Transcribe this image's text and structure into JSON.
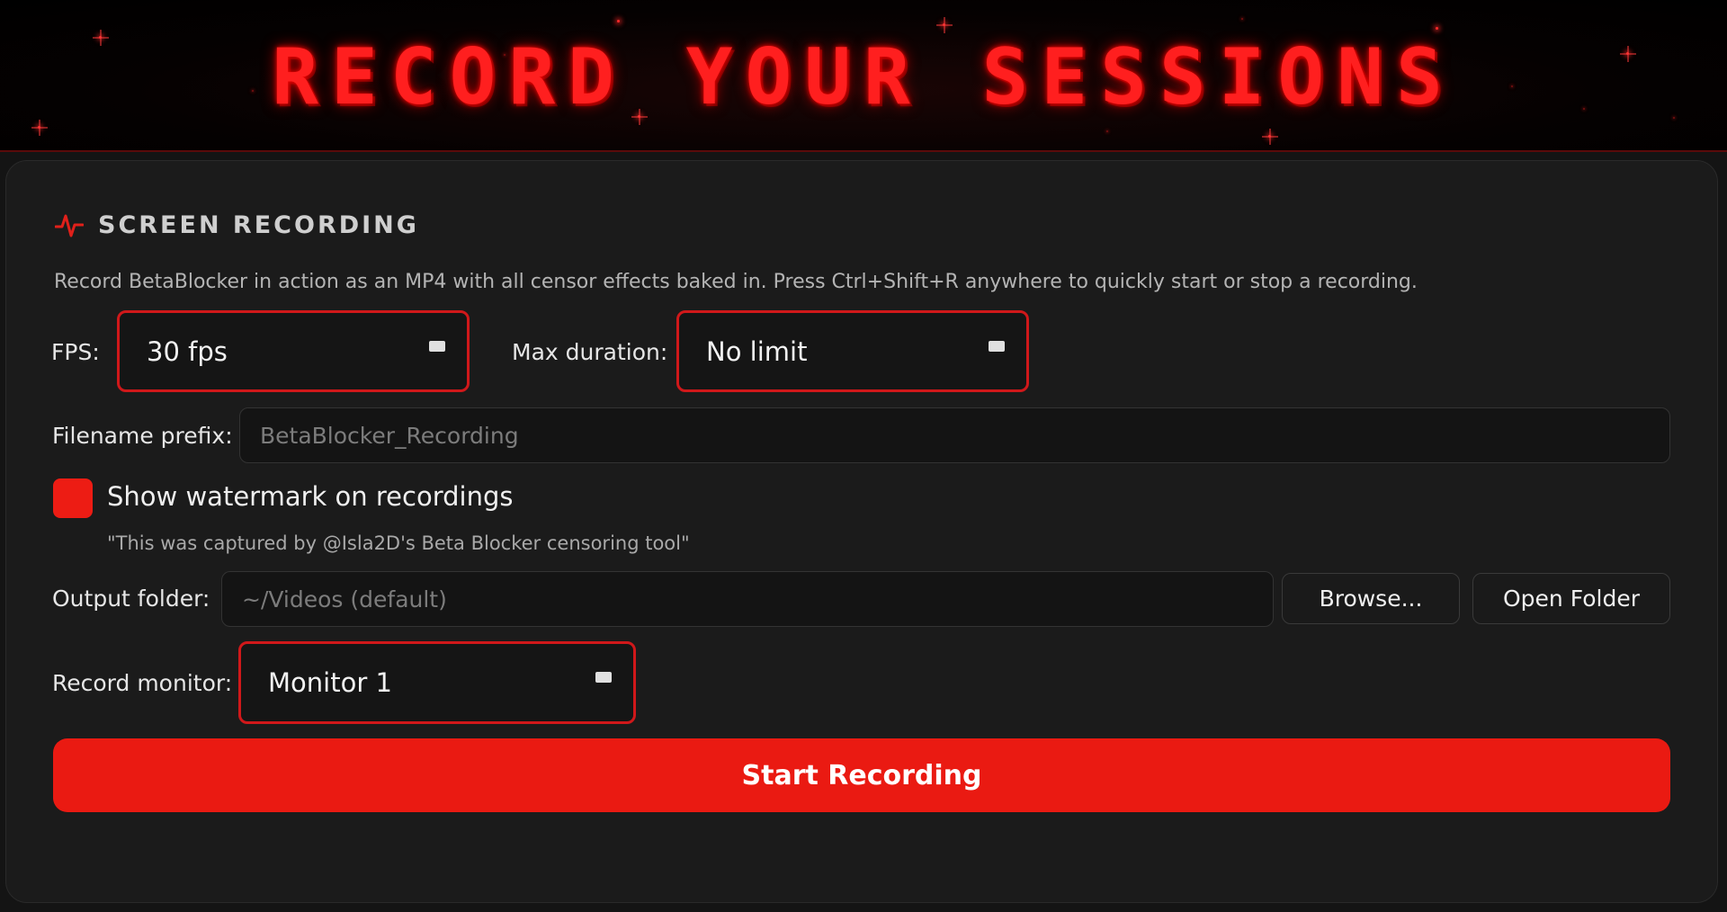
{
  "banner": {
    "title": "RECORD YOUR SESSIONS"
  },
  "section": {
    "icon": "pulse-icon",
    "title": "SCREEN RECORDING",
    "description": "Record BetaBlocker in action as an MP4 with all censor effects baked in.  Press Ctrl+Shift+R anywhere to quickly start or stop a recording."
  },
  "fps": {
    "label": "FPS:",
    "value": "30 fps"
  },
  "max_duration": {
    "label": "Max duration:",
    "value": "No limit"
  },
  "filename_prefix": {
    "label": "Filename prefix:",
    "placeholder": "BetaBlocker_Recording"
  },
  "watermark": {
    "label": "Show watermark on recordings",
    "checked": true,
    "note": "\"This was captured by @Isla2D's Beta Blocker censoring tool\""
  },
  "output_folder": {
    "label": "Output folder:",
    "placeholder": "~/Videos (default)",
    "browse_label": "Browse...",
    "open_label": "Open Folder"
  },
  "record_monitor": {
    "label": "Record monitor:",
    "value": "Monitor 1"
  },
  "start_button": {
    "label": "Start Recording"
  },
  "colors": {
    "accent": "#ea1a12",
    "background": "#141414",
    "panel": "#1b1b1b"
  }
}
